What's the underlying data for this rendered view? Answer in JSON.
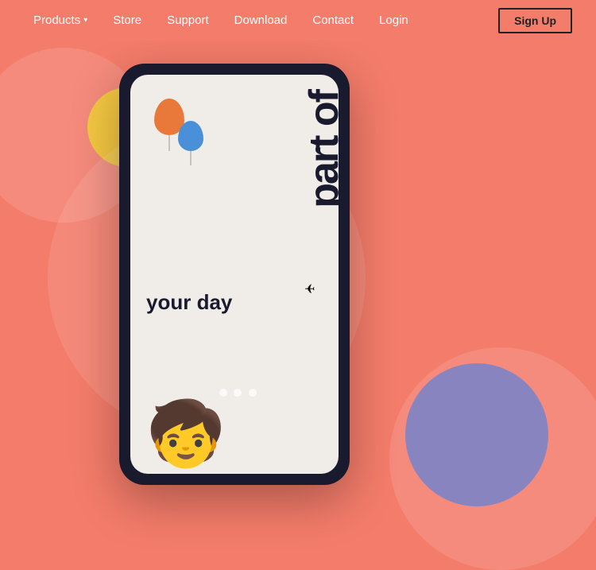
{
  "nav": {
    "products_label": "Products",
    "store_label": "Store",
    "support_label": "Support",
    "download_label": "Download",
    "contact_label": "Contact",
    "login_label": "Login",
    "signup_label": "Sign Up"
  },
  "hero": {
    "vertical_text": "part of",
    "your_day_text": "your day",
    "balloons": {
      "orange_color": "#e8793a",
      "blue_color": "#4a90d9"
    },
    "bg_color": "#f47c6a",
    "accent_blue": "#4a90d9",
    "accent_yellow": "#f5c842"
  }
}
